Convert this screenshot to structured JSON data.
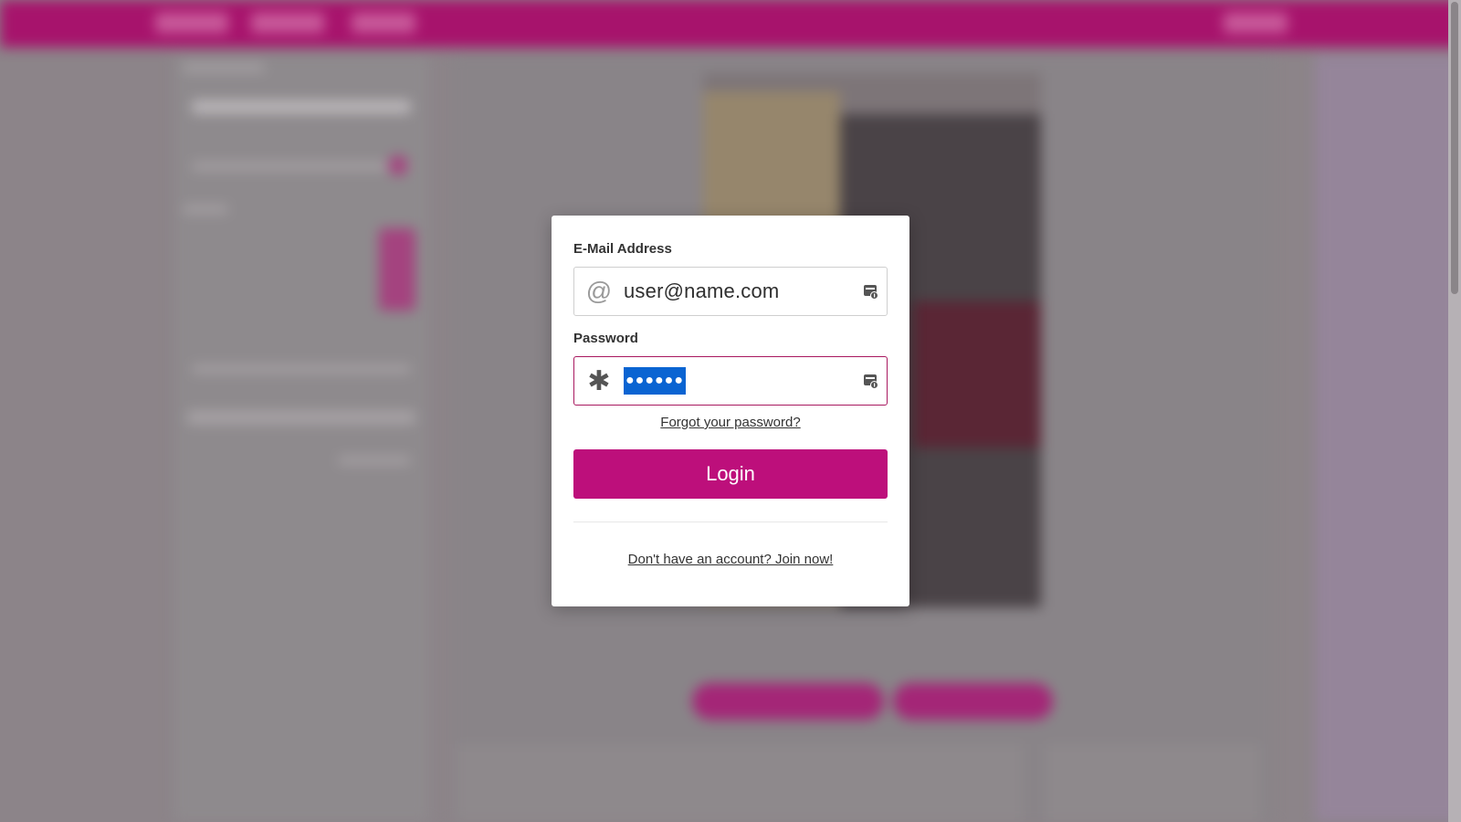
{
  "login_form": {
    "email_label": "E-Mail Address",
    "email_value": "user@name.com",
    "email_icon": "@",
    "password_label": "Password",
    "password_value": "●●●●●●",
    "password_icon": "✱",
    "forgot_password": "Forgot your password?",
    "login_button": "Login",
    "join_link": "Don't have an account? Join now!"
  },
  "icons": {
    "email_lead": "at-sign-icon",
    "password_lead": "asterisk-icon",
    "password_manager": "password-manager-icon"
  },
  "colors": {
    "brand": "#bd0f7b",
    "focus_border": "#a8185f",
    "selection": "#0a64d2"
  }
}
